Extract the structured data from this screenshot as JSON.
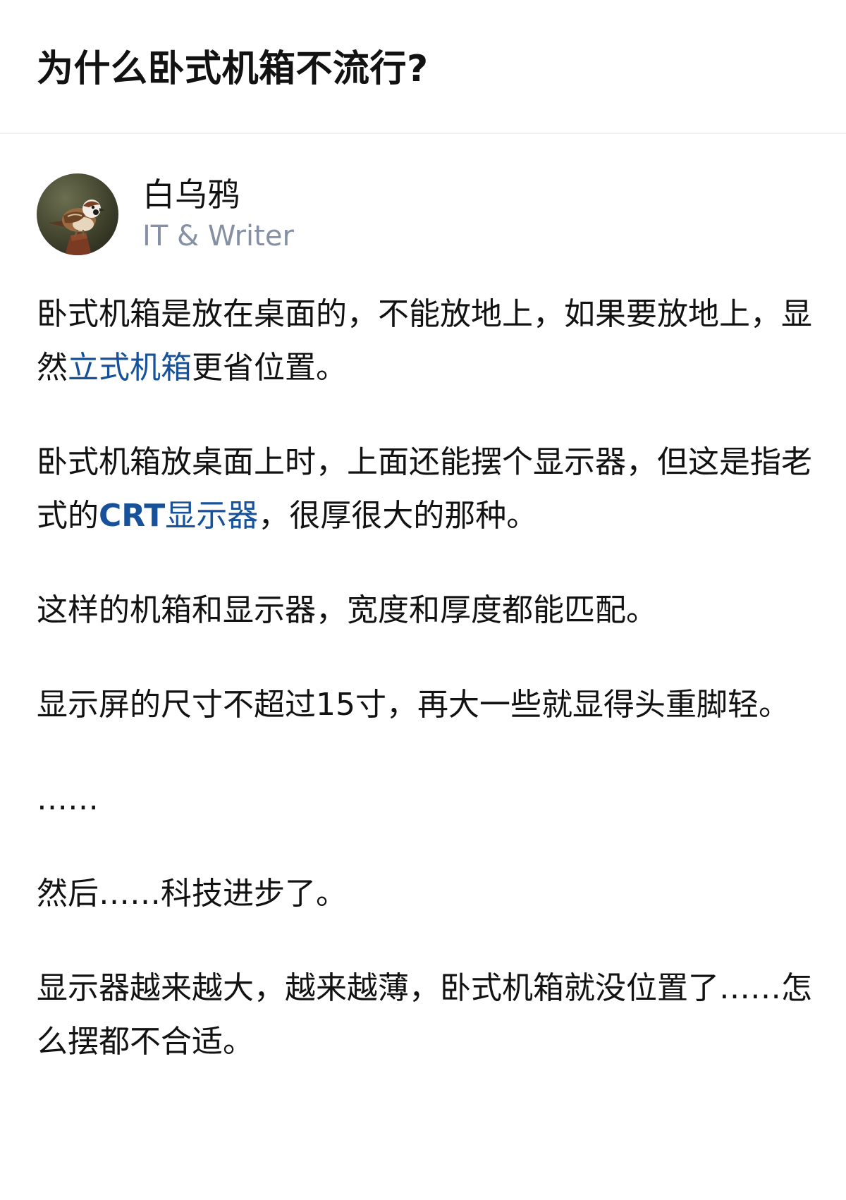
{
  "question": {
    "title": "为什么卧式机箱不流行?"
  },
  "author": {
    "name": "白乌鸦",
    "headline": "IT & Writer",
    "avatar_icon": "sparrow-avatar-icon"
  },
  "answer": {
    "p1": {
      "text_a": "卧式机箱是放在桌面的，不能放地上，如果要放地上，显然",
      "link": "立式机箱",
      "text_b": "更省位置。"
    },
    "p2": {
      "text_a": "卧式机箱放桌面上时，上面还能摆个显示器，但这是指老式的",
      "link_bold": "CRT",
      "link": "显示器",
      "text_b": "，很厚很大的那种。"
    },
    "p3": "这样的机箱和显示器，宽度和厚度都能匹配。",
    "p4": "显示屏的尺寸不超过15寸，再大一些就显得头重脚轻。",
    "p5": "……",
    "p6": "然后……科技进步了。",
    "p7": "显示器越来越大，越来越薄，卧式机箱就没位置了……怎么摆都不合适。"
  },
  "colors": {
    "link": "#175199",
    "headline": "#8590a6",
    "text": "#121212",
    "divider": "#f0f2f5"
  }
}
